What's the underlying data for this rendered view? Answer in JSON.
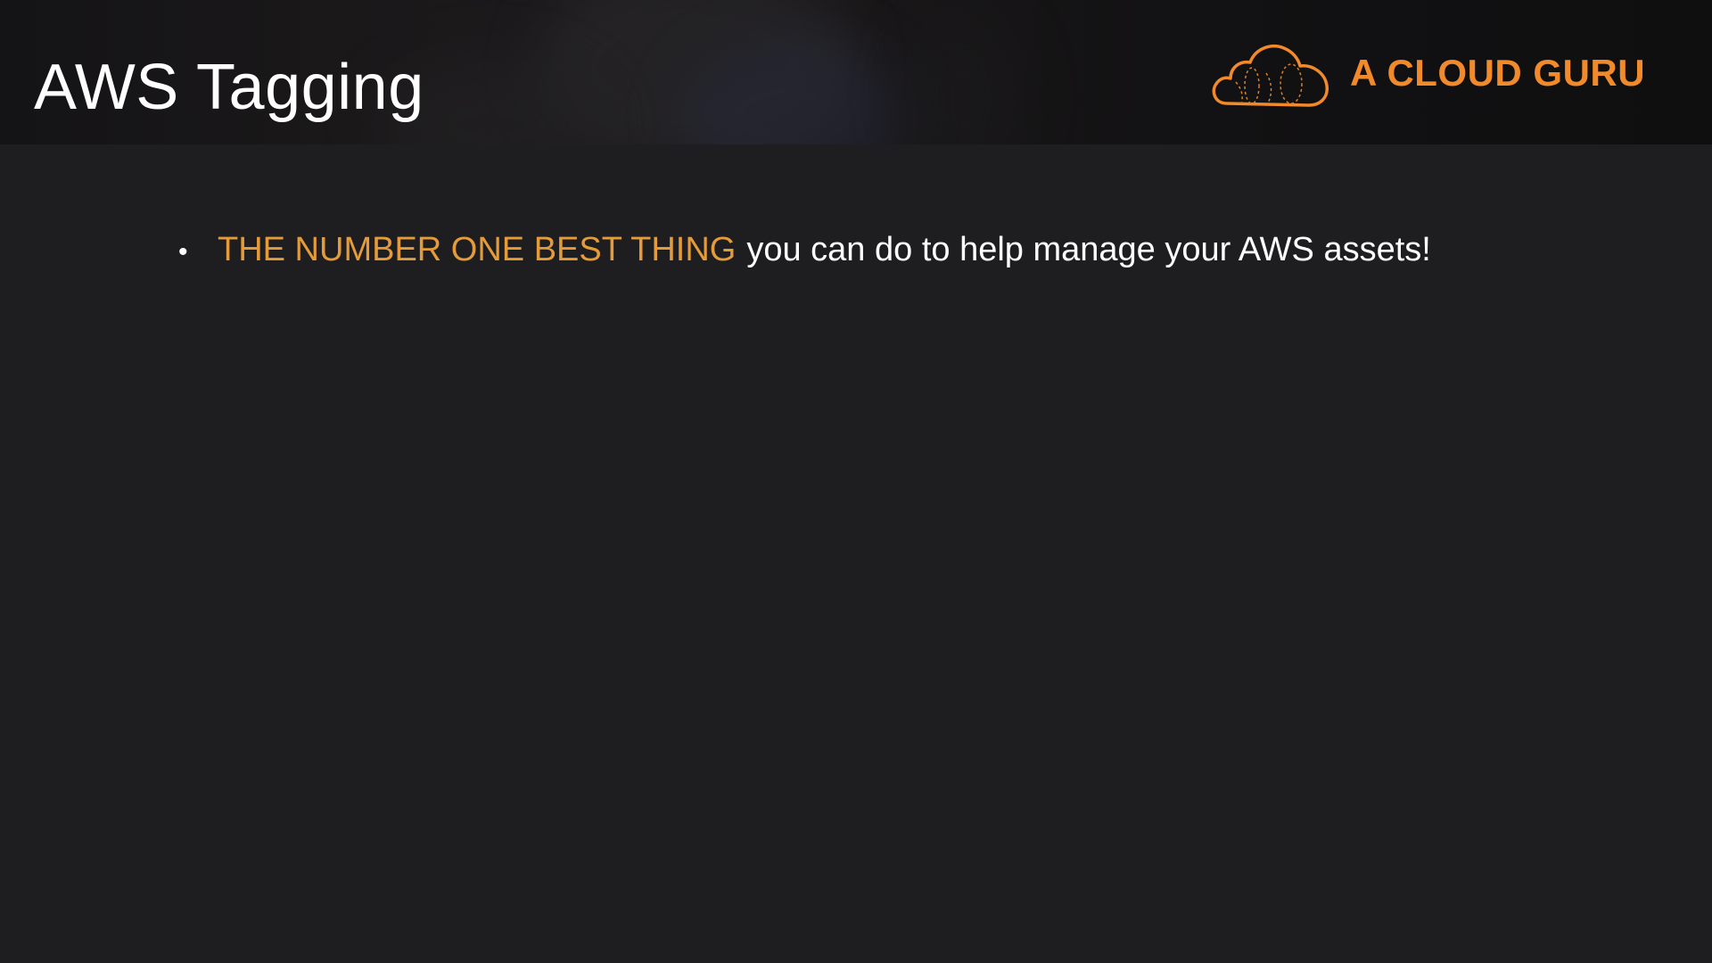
{
  "slide": {
    "title": "AWS Tagging"
  },
  "brand": {
    "name": "A CLOUD GURU",
    "logo_icon": "cloud-logo-icon",
    "color": "#f08a2a"
  },
  "bullets": [
    {
      "highlight": "THE NUMBER ONE BEST THING",
      "text": "you can do to help manage your AWS assets!",
      "highlight_color": "#e49b3a"
    }
  ],
  "colors": {
    "background": "#1e1d20",
    "text": "#ffffff"
  }
}
